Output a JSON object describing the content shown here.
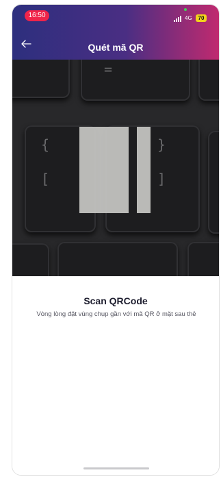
{
  "status_bar": {
    "time": "16:50",
    "network": "4G",
    "battery": "70"
  },
  "header": {
    "title": "Quét mã QR",
    "back_icon": "arrow-left-icon"
  },
  "scan": {
    "title": "Scan QRCode",
    "description": "Vòng lòng đặt vùng chụp gần với mã QR ở mặt sau thẻ"
  },
  "colors": {
    "header_gradient_start": "#2d2f7e",
    "header_gradient_end": "#c02a6f",
    "time_pill": "#f0244a",
    "battery": "#f1d31c"
  }
}
